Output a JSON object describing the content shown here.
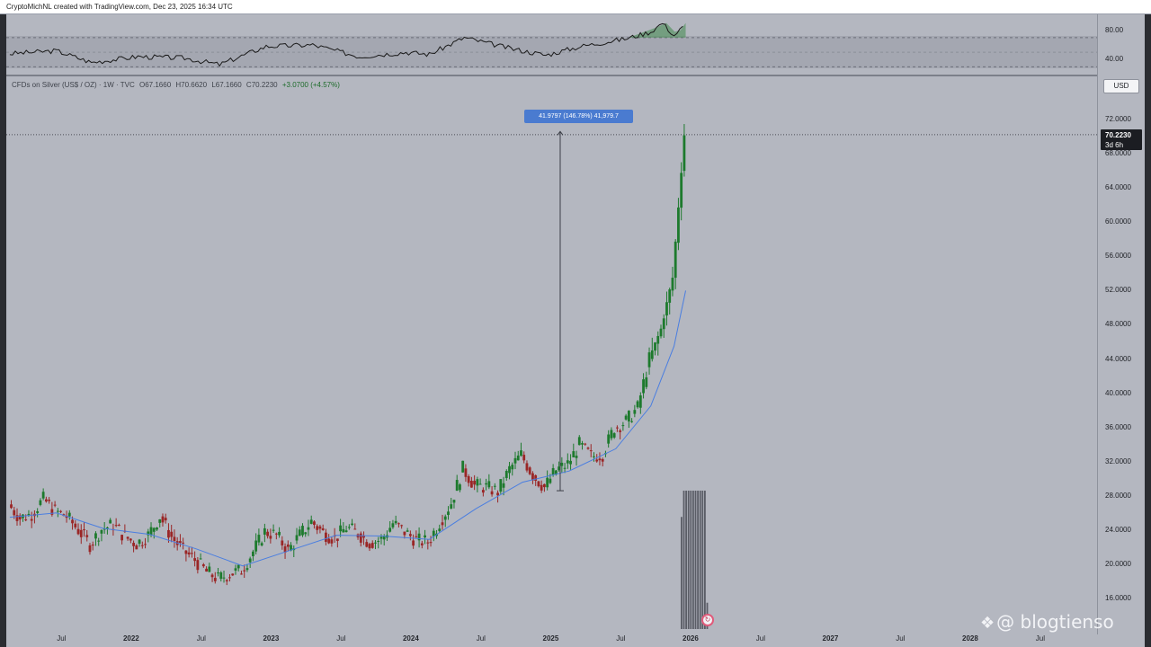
{
  "header": {
    "credit": "CryptoMichNL created with TradingView.com, Dec 23, 2025 16:34 UTC"
  },
  "legend": {
    "symbol": "CFDs on Silver (US$ / OZ) · 1W · TVC",
    "open": "O67.1660",
    "high": "H70.6620",
    "low": "L67.1660",
    "close": "C70.2230",
    "change": "+3.0700 (+4.57%)"
  },
  "toolbar": {
    "currency_label": "USD"
  },
  "last_price": {
    "value": "70.2230",
    "countdown": "3d 6h"
  },
  "measure": {
    "label": "41.9797 (146.78%) 41,979.7"
  },
  "watermark": {
    "text": "@ blogtienso",
    "icon": "binance-diamond-icon"
  },
  "colors": {
    "up": "#1d7a2d",
    "down": "#9a2626",
    "ma": "#4a7ee0",
    "rsi_line": "#1a1a1a",
    "rsi_overbought": "#3f8a4a"
  },
  "chart_data": [
    {
      "type": "candlestick",
      "title": "CFDs on Silver (US$ / OZ) · 1W · TVC",
      "x_ticks": [
        "Jul",
        "2022",
        "Jul",
        "2023",
        "Jul",
        "2024",
        "Jul",
        "2025",
        "Jul",
        "2026",
        "Jul",
        "2027",
        "Jul",
        "2028",
        "Jul"
      ],
      "y_ticks": [
        "72.0000",
        "68.0000",
        "64.0000",
        "60.0000",
        "56.0000",
        "52.0000",
        "48.0000",
        "44.0000",
        "40.0000",
        "36.0000",
        "32.0000",
        "28.0000",
        "24.0000",
        "20.0000",
        "16.0000"
      ],
      "ylim": [
        14,
        72
      ],
      "xlim": [
        2021.1,
        2028.9
      ],
      "grid": false,
      "legend_position": "top-left",
      "series_close": [
        {
          "date": "2021-02",
          "close": 27.0
        },
        {
          "date": "2021-03",
          "close": 25.4
        },
        {
          "date": "2021-04",
          "close": 25.9
        },
        {
          "date": "2021-05",
          "close": 27.6
        },
        {
          "date": "2021-06",
          "close": 26.2
        },
        {
          "date": "2021-07",
          "close": 25.6
        },
        {
          "date": "2021-08",
          "close": 24.0
        },
        {
          "date": "2021-09",
          "close": 22.3
        },
        {
          "date": "2021-10",
          "close": 24.1
        },
        {
          "date": "2021-11",
          "close": 24.6
        },
        {
          "date": "2021-12",
          "close": 23.2
        },
        {
          "date": "2022-01",
          "close": 22.4
        },
        {
          "date": "2022-02",
          "close": 23.4
        },
        {
          "date": "2022-03",
          "close": 25.6
        },
        {
          "date": "2022-04",
          "close": 23.2
        },
        {
          "date": "2022-05",
          "close": 21.6
        },
        {
          "date": "2022-06",
          "close": 20.5
        },
        {
          "date": "2022-07",
          "close": 19.1
        },
        {
          "date": "2022-08",
          "close": 18.3
        },
        {
          "date": "2022-09",
          "close": 18.9
        },
        {
          "date": "2022-10",
          "close": 19.3
        },
        {
          "date": "2022-11",
          "close": 21.5
        },
        {
          "date": "2022-12",
          "close": 23.8
        },
        {
          "date": "2023-01",
          "close": 23.4
        },
        {
          "date": "2023-02",
          "close": 21.6
        },
        {
          "date": "2023-03",
          "close": 23.4
        },
        {
          "date": "2023-04",
          "close": 25.0
        },
        {
          "date": "2023-05",
          "close": 23.7
        },
        {
          "date": "2023-06",
          "close": 23.0
        },
        {
          "date": "2023-07",
          "close": 24.3
        },
        {
          "date": "2023-08",
          "close": 23.6
        },
        {
          "date": "2023-09",
          "close": 22.5
        },
        {
          "date": "2023-10",
          "close": 22.9
        },
        {
          "date": "2023-11",
          "close": 24.8
        },
        {
          "date": "2023-12",
          "close": 23.8
        },
        {
          "date": "2024-01",
          "close": 22.8
        },
        {
          "date": "2024-02",
          "close": 22.6
        },
        {
          "date": "2024-03",
          "close": 24.9
        },
        {
          "date": "2024-04",
          "close": 27.2
        },
        {
          "date": "2024-05",
          "close": 31.2
        },
        {
          "date": "2024-06",
          "close": 29.2
        },
        {
          "date": "2024-07",
          "close": 29.0
        },
        {
          "date": "2024-08",
          "close": 28.5
        },
        {
          "date": "2024-09",
          "close": 31.1
        },
        {
          "date": "2024-10",
          "close": 32.8
        },
        {
          "date": "2024-11",
          "close": 30.4
        },
        {
          "date": "2024-12",
          "close": 29.0
        },
        {
          "date": "2025-01",
          "close": 31.0
        },
        {
          "date": "2025-02",
          "close": 31.7
        },
        {
          "date": "2025-03",
          "close": 34.0
        },
        {
          "date": "2025-04",
          "close": 32.6
        },
        {
          "date": "2025-05",
          "close": 32.9
        },
        {
          "date": "2025-06",
          "close": 36.0
        },
        {
          "date": "2025-07",
          "close": 36.7
        },
        {
          "date": "2025-08",
          "close": 38.3
        },
        {
          "date": "2025-09",
          "close": 44.0
        },
        {
          "date": "2025-10",
          "close": 47.5
        },
        {
          "date": "2025-11",
          "close": 53.5
        },
        {
          "date": "2025-12",
          "close": 70.22
        }
      ],
      "moving_average": [
        {
          "date": "2021-02",
          "value": 25.5
        },
        {
          "date": "2021-06",
          "value": 26.0
        },
        {
          "date": "2021-10",
          "value": 24.2
        },
        {
          "date": "2022-02",
          "value": 23.5
        },
        {
          "date": "2022-06",
          "value": 21.8
        },
        {
          "date": "2022-10",
          "value": 19.8
        },
        {
          "date": "2023-02",
          "value": 21.6
        },
        {
          "date": "2023-06",
          "value": 23.4
        },
        {
          "date": "2023-10",
          "value": 23.3
        },
        {
          "date": "2024-02",
          "value": 22.9
        },
        {
          "date": "2024-06",
          "value": 26.5
        },
        {
          "date": "2024-10",
          "value": 29.6
        },
        {
          "date": "2025-02",
          "value": 30.9
        },
        {
          "date": "2025-06",
          "value": 33.5
        },
        {
          "date": "2025-09",
          "value": 38.5
        },
        {
          "date": "2025-11",
          "value": 45.5
        },
        {
          "date": "2025-12",
          "value": 52.0
        }
      ],
      "measure_tool": {
        "label": "41.9797 (146.78%) 41,979.7",
        "from_price": 28.6,
        "to_price": 70.6,
        "date": "2025-01"
      },
      "last_price": 70.223,
      "volume_bar_heights_relative": [
        0.81,
        1,
        1,
        1,
        1,
        1,
        1,
        1,
        1,
        1,
        1,
        0.19
      ]
    },
    {
      "type": "line",
      "title": "",
      "y_ticks": [
        "80.00",
        "40.00"
      ],
      "ylim": [
        28,
        92
      ],
      "overbought": 70,
      "oversold": 30,
      "note_band": "30–70 shaded",
      "series_points": [
        {
          "date": "2021-02",
          "value": 48
        },
        {
          "date": "2021-06",
          "value": 52
        },
        {
          "date": "2021-09",
          "value": 36
        },
        {
          "date": "2022-01",
          "value": 44
        },
        {
          "date": "2022-05",
          "value": 42
        },
        {
          "date": "2022-08",
          "value": 33
        },
        {
          "date": "2022-12",
          "value": 58
        },
        {
          "date": "2023-04",
          "value": 60
        },
        {
          "date": "2023-08",
          "value": 44
        },
        {
          "date": "2023-12",
          "value": 50
        },
        {
          "date": "2024-02",
          "value": 47
        },
        {
          "date": "2024-05",
          "value": 70
        },
        {
          "date": "2024-09",
          "value": 55
        },
        {
          "date": "2024-12",
          "value": 46
        },
        {
          "date": "2025-03",
          "value": 58
        },
        {
          "date": "2025-07",
          "value": 69
        },
        {
          "date": "2025-09",
          "value": 78
        },
        {
          "date": "2025-10",
          "value": 90
        },
        {
          "date": "2025-11",
          "value": 73
        },
        {
          "date": "2025-12",
          "value": 88
        }
      ]
    }
  ]
}
